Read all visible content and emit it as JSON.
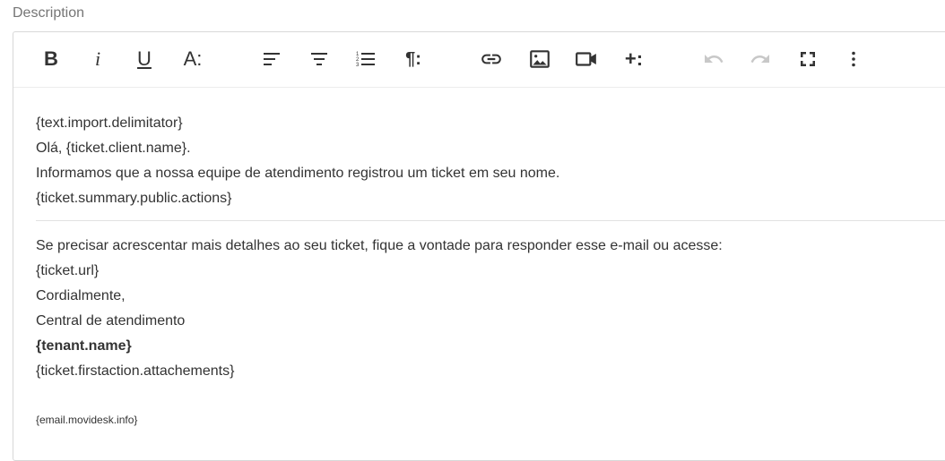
{
  "field": {
    "label": "Description"
  },
  "toolbar": {
    "buttons": [
      {
        "name": "bold",
        "icon": "bold-icon",
        "glyph": "B"
      },
      {
        "name": "italic",
        "icon": "italic-icon",
        "glyph": "i"
      },
      {
        "name": "underline",
        "icon": "underline-icon",
        "glyph": "U"
      },
      {
        "name": "font-size",
        "icon": "font-size-icon",
        "glyph": "A:"
      },
      {
        "name": "align",
        "icon": "align-left-icon"
      },
      {
        "name": "format",
        "icon": "paragraph-format-icon"
      },
      {
        "name": "ordered-list",
        "icon": "ordered-list-icon"
      },
      {
        "name": "paragraph-style",
        "icon": "paragraph-icon",
        "glyph": "¶:"
      },
      {
        "name": "link",
        "icon": "link-icon"
      },
      {
        "name": "image",
        "icon": "image-icon"
      },
      {
        "name": "video",
        "icon": "video-icon"
      },
      {
        "name": "more-insert",
        "icon": "plus-more-icon",
        "glyph": "+:"
      },
      {
        "name": "undo",
        "icon": "undo-icon",
        "disabled": true
      },
      {
        "name": "redo",
        "icon": "redo-icon",
        "disabled": true
      },
      {
        "name": "fullscreen",
        "icon": "fullscreen-icon"
      },
      {
        "name": "more",
        "icon": "more-vertical-icon"
      }
    ]
  },
  "editor": {
    "block1": [
      "{text.import.delimitator}",
      "Olá, {ticket.client.name}.",
      "Informamos que a nossa equipe de atendimento registrou um ticket em seu nome.",
      "{ticket.summary.public.actions}"
    ],
    "block2": [
      "Se precisar acrescentar mais detalhes ao seu ticket, fique a vontade para responder esse e-mail ou acesse:",
      "{ticket.url}",
      "Cordialmente,",
      "Central de atendimento"
    ],
    "bold_line": "{tenant.name}",
    "attachments_line": "{ticket.firstaction.attachements}",
    "footer_line": "{email.movidesk.info}"
  },
  "colors": {
    "text": "#333333",
    "label": "#757575",
    "border": "#d8d8d8",
    "disabled_icon": "#c8c8c8"
  }
}
